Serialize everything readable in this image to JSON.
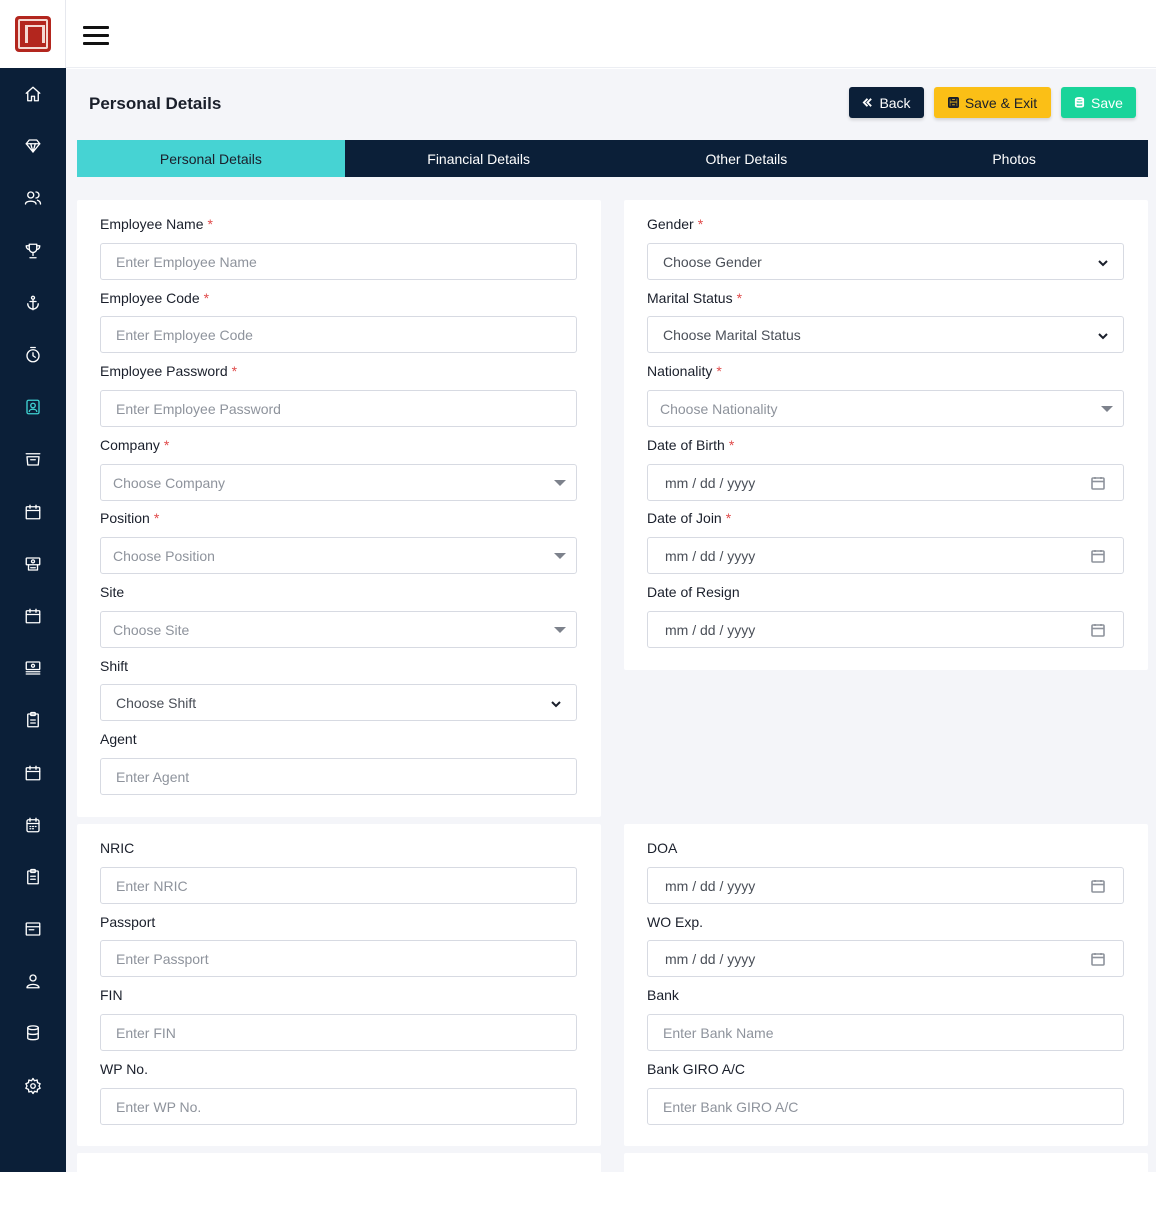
{
  "nav": {
    "items": [
      {
        "icon": "home-icon"
      },
      {
        "icon": "diamond-icon"
      },
      {
        "icon": "users-icon"
      },
      {
        "icon": "trophy-icon"
      },
      {
        "icon": "anchor-icon"
      },
      {
        "icon": "stopwatch-icon"
      },
      {
        "icon": "id-badge-icon"
      },
      {
        "icon": "inbox-icon"
      },
      {
        "icon": "calendar-icon"
      },
      {
        "icon": "cash-register-icon"
      },
      {
        "icon": "calendar-alt-icon"
      },
      {
        "icon": "money-bill-icon"
      },
      {
        "icon": "clipboard-icon"
      },
      {
        "icon": "calendar-week-icon"
      },
      {
        "icon": "calendar-grid-icon"
      },
      {
        "icon": "clipboard-list-icon"
      },
      {
        "icon": "window-icon"
      },
      {
        "icon": "user-icon"
      },
      {
        "icon": "database-icon"
      },
      {
        "icon": "settings-icon"
      }
    ],
    "active_index": 6
  },
  "header": {
    "title": "Personal Details",
    "back_label": "Back",
    "save_exit_label": "Save & Exit",
    "save_label": "Save"
  },
  "tabs": [
    {
      "label": "Personal Details",
      "active": true
    },
    {
      "label": "Financial Details",
      "active": false
    },
    {
      "label": "Other Details",
      "active": false
    },
    {
      "label": "Photos",
      "active": false
    }
  ],
  "form_left": {
    "employee_name": {
      "label": "Employee Name",
      "placeholder": "Enter Employee Name"
    },
    "employee_code": {
      "label": "Employee Code",
      "placeholder": "Enter Employee Code"
    },
    "employee_password": {
      "label": "Employee Password",
      "placeholder": "Enter Employee Password"
    },
    "company": {
      "label": "Company",
      "value": "Choose Company"
    },
    "position": {
      "label": "Position",
      "value": "Choose Position"
    },
    "site": {
      "label": "Site",
      "value": "Choose Site"
    },
    "shift": {
      "label": "Shift",
      "value": "Choose Shift"
    },
    "agent": {
      "label": "Agent",
      "placeholder": "Enter Agent"
    }
  },
  "form_right": {
    "gender": {
      "label": "Gender",
      "value": "Choose Gender"
    },
    "marital_status": {
      "label": "Marital Status",
      "value": "Choose Marital Status"
    },
    "nationality": {
      "label": "Nationality",
      "value": "Choose Nationality"
    },
    "date_of_birth": {
      "label": "Date of Birth",
      "value": "mm / dd / yyyy"
    },
    "date_of_join": {
      "label": "Date of Join",
      "value": "mm / dd / yyyy"
    },
    "date_of_resign": {
      "label": "Date of Resign",
      "value": "mm / dd / yyyy"
    }
  },
  "form_left2": {
    "nric": {
      "label": "NRIC",
      "placeholder": "Enter NRIC"
    },
    "passport": {
      "label": "Passport",
      "placeholder": "Enter Passport"
    },
    "fin": {
      "label": "FIN",
      "placeholder": "Enter FIN"
    },
    "wp_no": {
      "label": "WP No.",
      "placeholder": "Enter WP No."
    }
  },
  "form_right2": {
    "doa": {
      "label": "DOA",
      "value": "mm / dd / yyyy"
    },
    "wo_exp": {
      "label": "WO Exp.",
      "value": "mm / dd / yyyy"
    },
    "bank": {
      "label": "Bank",
      "placeholder": "Enter Bank Name"
    },
    "bank_giro": {
      "label": "Bank GIRO A/C",
      "placeholder": "Enter Bank GIRO A/C"
    }
  },
  "colors": {
    "sidebar": "#0b1f38",
    "active_tab": "#46d3d3",
    "save_exit": "#fbbf16",
    "save": "#19d49a",
    "required": "#e04a4a"
  }
}
